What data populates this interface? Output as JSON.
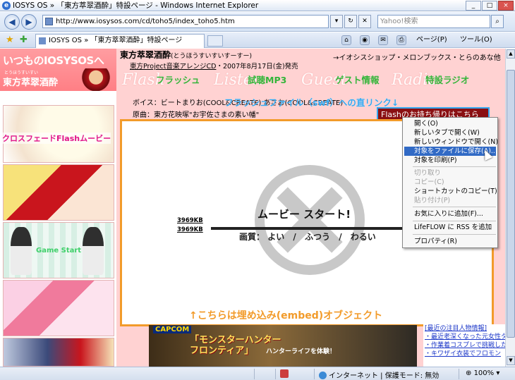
{
  "window": {
    "title": "IOSYS OS » 「東方萃翠酒酔」特設ページ - Windows Internet Explorer",
    "buttons": [
      "_",
      "□",
      "×"
    ]
  },
  "address_bar": {
    "url": "http://www.iosysos.com/cd/toho5/index_toho5.htm",
    "search_placeholder": "Yahoo!検索",
    "back_icon": "back-arrow-icon",
    "forward_icon": "forward-arrow-icon"
  },
  "tabbar": {
    "tab_title": "IOSYS OS » 「東方萃翠酒酔」特設ページ",
    "commands": {
      "page": "ページ(P)",
      "tools": "ツール(O)"
    }
  },
  "site": {
    "logo_line1": "いつものIOSYSOSへ",
    "logo_small": "とうほうすいすい",
    "logo_line2": "東方萃翠酒酔",
    "title": "東方萃翠酒酔",
    "title_reading": "(とうほうすいすいすーすー)",
    "shop_links": "→イオシスショップ・メロンブックス・とらのあな他",
    "cd_link": "東方Project音楽アレンジCD",
    "cd_info": "・2007年8月17日(金)発売",
    "nav": [
      {
        "bg": "Flash",
        "jp": "フラッシュ"
      },
      {
        "bg": "Listen",
        "jp": "試聴MP3"
      },
      {
        "bg": "Guest",
        "jp": "ゲスト情報"
      },
      {
        "bg": "Radio",
        "jp": "特設ラジオ"
      }
    ],
    "voice": "ボイス：ビートまりお(COOL&CREATE)  あさお(COOL&CREATE)",
    "origin": "原曲：東方花映塚\"お宇佐さまの素い幡\"",
    "flash_direct_link": "フラッシュファイル（swf）への直リンク↓",
    "flash_button": "Flashのお持ち帰りはこちら",
    "thumb_captions": {
      "crossfade": "クロスフェードFlashムービー",
      "game": "Game Start"
    },
    "embed_caption": "↑こちらは埋め込み(embed)オブジェクト"
  },
  "flash_player": {
    "title": "ムービー スタート!",
    "quality_label": "画質：",
    "quality_options": [
      "よい",
      "ふつう",
      "わるい"
    ],
    "separator": "/",
    "size_1": "3969KB",
    "size_2": "3969KB"
  },
  "banner": {
    "brand": "CAPCOM",
    "title_line1": "「モンスターハンター",
    "title_line2": "フロンティア」",
    "tagline": "ハンターライフを体験！"
  },
  "news": [
    "[最近の注目人物情報]",
    "・最近老深くなった元女性タ",
    "・作業着コスプレで挑戦した",
    "・キワザイ衣装でフロモン"
  ],
  "context_menu": {
    "items": [
      {
        "label": "開く(O)",
        "state": "normal"
      },
      {
        "label": "新しいタブで開く(W)",
        "state": "normal"
      },
      {
        "label": "新しいウィンドウで開く(N)",
        "state": "normal"
      },
      {
        "label": "対象をファイルに保存(A)...",
        "state": "highlighted"
      },
      {
        "label": "対象を印刷(P)",
        "state": "normal"
      },
      {
        "label": "切り取り",
        "state": "disabled"
      },
      {
        "label": "コピー(C)",
        "state": "disabled"
      },
      {
        "label": "ショートカットのコピー(T)",
        "state": "normal"
      },
      {
        "label": "貼り付け(P)",
        "state": "disabled"
      },
      {
        "label": "お気に入りに追加(F)...",
        "state": "normal"
      },
      {
        "label": "LifeFLOW に RSS を追加",
        "state": "normal"
      },
      {
        "label": "プロパティ(R)",
        "state": "normal"
      }
    ]
  },
  "status_bar": {
    "zone": "インターネット | 保護モード: 無効",
    "zoom": "100%"
  }
}
